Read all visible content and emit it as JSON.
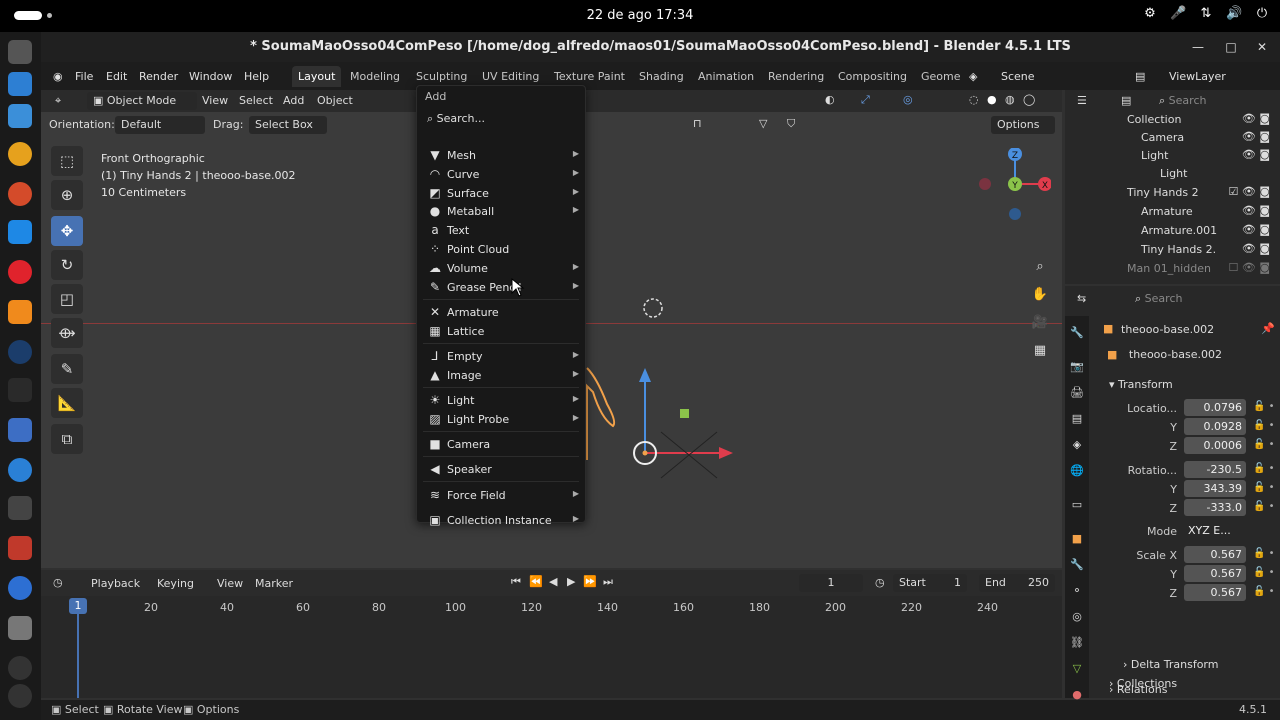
{
  "system": {
    "clock": "22 de ago  17:34"
  },
  "window": {
    "title": "* SoumaMaoOsso04ComPeso [/home/dog_alfredo/maos01/SoumaMaoOsso04ComPeso.blend] - Blender 4.5.1 LTS"
  },
  "menubar": {
    "items": [
      "File",
      "Edit",
      "Render",
      "Window",
      "Help"
    ],
    "workspaces": [
      "Layout",
      "Modeling",
      "Sculpting",
      "UV Editing",
      "Texture Paint",
      "Shading",
      "Animation",
      "Rendering",
      "Compositing",
      "Geome"
    ],
    "scene": "Scene",
    "view_layer": "ViewLayer"
  },
  "viewport": {
    "mode": "Object Mode",
    "menus": [
      "View",
      "Select",
      "Add",
      "Object"
    ],
    "orientation_label": "Orientation:",
    "orientation_value": "Default",
    "drag_label": "Drag:",
    "drag_value": "Select Box",
    "options_label": "Options",
    "info_line1": "Front Orthographic",
    "info_line2": "(1) Tiny Hands 2 | theooo-base.002",
    "info_line3": "10 Centimeters",
    "gizmo_axes": [
      "Z",
      "Y",
      "X"
    ]
  },
  "add_menu": {
    "title": "Add",
    "search": "Search...",
    "items": [
      {
        "label": "Mesh",
        "icon": "mesh-icon",
        "glyph": "▼",
        "submenu": true
      },
      {
        "label": "Curve",
        "icon": "curve-icon",
        "glyph": "◠",
        "submenu": true
      },
      {
        "label": "Surface",
        "icon": "surface-icon",
        "glyph": "◩",
        "submenu": true
      },
      {
        "label": "Metaball",
        "icon": "metaball-icon",
        "glyph": "●",
        "submenu": true
      },
      {
        "label": "Text",
        "icon": "text-icon",
        "glyph": "a",
        "submenu": false
      },
      {
        "label": "Point Cloud",
        "icon": "point-cloud-icon",
        "glyph": "⁘",
        "submenu": false
      },
      {
        "label": "Volume",
        "icon": "volume-icon",
        "glyph": "☁",
        "submenu": true
      },
      {
        "label": "Grease Pencil",
        "icon": "grease-pencil-icon",
        "glyph": "✎",
        "submenu": true
      },
      {
        "label": "Armature",
        "icon": "armature-icon",
        "glyph": "✕",
        "submenu": false
      },
      {
        "label": "Lattice",
        "icon": "lattice-icon",
        "glyph": "▦",
        "submenu": false
      },
      {
        "label": "Empty",
        "icon": "empty-icon",
        "glyph": "⅃",
        "submenu": true
      },
      {
        "label": "Image",
        "icon": "image-icon",
        "glyph": "▲",
        "submenu": true
      },
      {
        "label": "Light",
        "icon": "light-icon",
        "glyph": "☀",
        "submenu": true
      },
      {
        "label": "Light Probe",
        "icon": "light-probe-icon",
        "glyph": "▨",
        "submenu": true
      },
      {
        "label": "Camera",
        "icon": "camera-icon",
        "glyph": "■",
        "submenu": false
      },
      {
        "label": "Speaker",
        "icon": "speaker-icon",
        "glyph": "◀",
        "submenu": false
      },
      {
        "label": "Force Field",
        "icon": "force-field-icon",
        "glyph": "≋",
        "submenu": true
      },
      {
        "label": "Collection Instance",
        "icon": "collection-instance-icon",
        "glyph": "▣",
        "submenu": true
      }
    ]
  },
  "outliner": {
    "search_placeholder": "Search",
    "rows": [
      {
        "label": "Collection",
        "icon": "collection-icon"
      },
      {
        "label": "Camera",
        "icon": "camera-icon"
      },
      {
        "label": "Light",
        "icon": "light-icon"
      },
      {
        "label": "Light",
        "icon": "light-data-icon"
      },
      {
        "label": "Tiny Hands 2",
        "icon": "collection-icon"
      },
      {
        "label": "Armature",
        "icon": "armature-icon"
      },
      {
        "label": "Armature.001",
        "icon": "armature-icon"
      },
      {
        "label": "Tiny Hands 2.",
        "icon": "armature-icon"
      },
      {
        "label": "Man 01_hidden",
        "icon": "collection-icon"
      }
    ]
  },
  "properties": {
    "search_placeholder": "Search",
    "object_name": "theooo-base.002",
    "data_name": "theooo-base.002",
    "transform_label": "Transform",
    "location_label": "Locatio...",
    "location": [
      "0.0796",
      "0.0928",
      "0.0006"
    ],
    "rotation_label": "Rotatio...",
    "rotation": [
      "-230.5",
      "343.39",
      "-333.0"
    ],
    "mode_label": "Mode",
    "mode_value": "XYZ E...",
    "scale_label": "Scale X",
    "scale": [
      "0.567",
      "0.567",
      "0.567"
    ],
    "axis_y": "Y",
    "axis_z": "Z",
    "delta_transform": "Delta Transform",
    "relations": "Relations",
    "collections": "Collections"
  },
  "timeline": {
    "menus": [
      "Playback",
      "Keying",
      "View",
      "Marker"
    ],
    "current_frame": "1",
    "start_label": "Start",
    "start_value": "1",
    "end_label": "End",
    "end_value": "250",
    "ticks": [
      "20",
      "40",
      "60",
      "80",
      "100",
      "120",
      "140",
      "160",
      "180",
      "200",
      "220",
      "240"
    ],
    "playhead": "1"
  },
  "statusbar": {
    "items": [
      "Select",
      "Rotate View",
      "Options"
    ],
    "version": "4.5.1"
  },
  "colors": {
    "accent": "#4772b3",
    "x_axis": "#e03c4c",
    "y_axis": "#8bc34a",
    "z_axis": "#4a8fe0",
    "selection_orange": "#f2a14a"
  }
}
